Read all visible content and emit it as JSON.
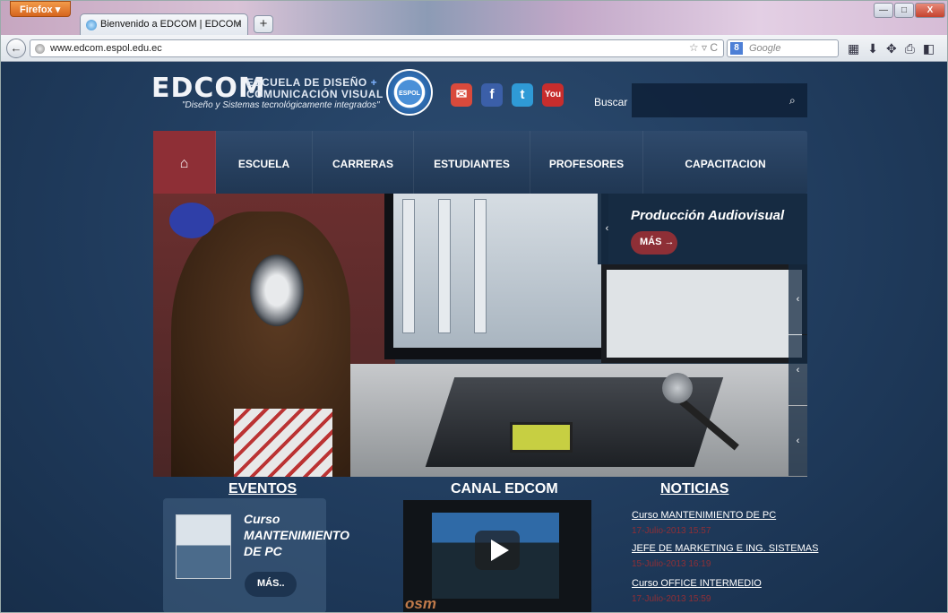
{
  "browser": {
    "app_button": "Firefox",
    "tab_title": "Bienvenido a EDCOM | EDCOM",
    "url": "www.edcom.espol.edu.ec",
    "search_engine_placeholder": "Google"
  },
  "header": {
    "logo": "EDCOM",
    "school_line1": "ESCUELA DE DISEÑO",
    "school_line1_plus": "+",
    "school_line2": "COMUNICACIÓN VISUAL",
    "tagline": "\"Diseño y Sistemas tecnológicamente integrados\"",
    "seal_label": "ESPOL",
    "search_label": "Buscar",
    "social": [
      {
        "name": "email-icon",
        "glyph": "✉",
        "color": "#d94a3c"
      },
      {
        "name": "facebook-icon",
        "glyph": "f",
        "color": "#3b5fa8"
      },
      {
        "name": "twitter-icon",
        "glyph": "t",
        "color": "#2f9ad6"
      },
      {
        "name": "youtube-icon",
        "glyph": "You",
        "color": "#c72d2d"
      }
    ]
  },
  "menu": {
    "home_glyph": "⌂",
    "items": [
      "ESCUELA",
      "CARRERAS",
      "ESTUDIANTES",
      "PROFESORES",
      "CAPACITACION"
    ]
  },
  "slider": {
    "title": "Producción Audiovisual",
    "more_label": "MÁS",
    "arrow": "‹"
  },
  "events": {
    "heading": "EVENTOS",
    "title": "Curso MANTENIMIENTO DE PC",
    "more_label": "MÁS.."
  },
  "canal": {
    "heading": "CANAL EDCOM",
    "brand": "osm"
  },
  "news": {
    "heading": "NOTICIAS",
    "items": [
      {
        "title": "Curso MANTENIMIENTO DE PC",
        "date": "17-Julio-2013 15:57"
      },
      {
        "title": "JEFE DE MARKETING E ING. SISTEMAS",
        "date": "15-Julio-2013 16:19"
      },
      {
        "title": "Curso OFFICE INTERMEDIO",
        "date": "17-Julio-2013 15:59"
      }
    ]
  },
  "colors": {
    "accent_red": "#8e2f36",
    "page_blue": "#1f3a5b"
  }
}
